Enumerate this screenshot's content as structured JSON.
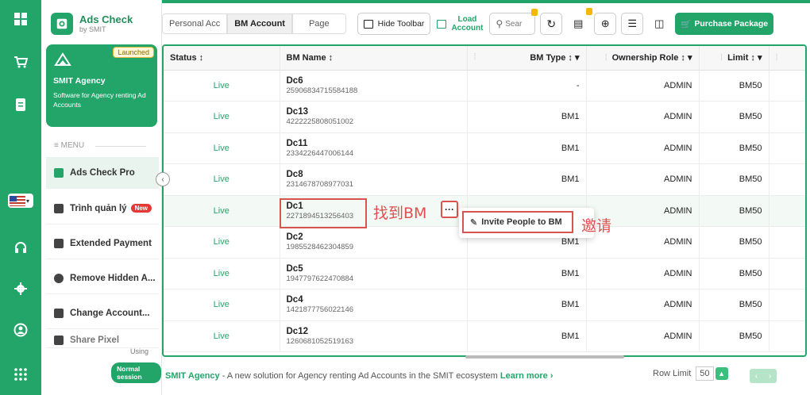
{
  "brand": {
    "name": "Ads Check",
    "sub": "by SMIT"
  },
  "agency_card": {
    "badge": "Launched",
    "title": "SMIT Agency",
    "desc": "Software for Agency renting Ad Accounts"
  },
  "menu": {
    "header": "≡ MENU",
    "items": [
      {
        "label": "Ads Check Pro"
      },
      {
        "label": "Trình quản lý",
        "badge": "New"
      },
      {
        "label": "Extended Payment"
      },
      {
        "label": "Remove Hidden A..."
      },
      {
        "label": "Change Account..."
      },
      {
        "label": "Share Pixel"
      }
    ]
  },
  "session": {
    "using": "Using",
    "badge": "Normal session"
  },
  "toolbar": {
    "tabs": [
      "Personal Acc",
      "BM Account",
      "Page"
    ],
    "hide_toolbar": "Hide Toolbar",
    "load_1": "Load",
    "load_2": "Account",
    "search_placeholder": "Sear",
    "purchase": "Purchase Package"
  },
  "table": {
    "headers": {
      "status": "Status ↕",
      "bm_name": "BM Name ↕",
      "bm_type": "BM Type ↕ ▾",
      "role": "Ownership Role ↕ ▾",
      "limit": "Limit ↕ ▾"
    },
    "rows": [
      {
        "status": "Live",
        "name": "Dc6",
        "id": "25906834715584188",
        "type": "-",
        "role": "ADMIN",
        "limit": "BM50"
      },
      {
        "status": "Live",
        "name": "Dc13",
        "id": "4222225808051002",
        "type": "BM1",
        "role": "ADMIN",
        "limit": "BM50"
      },
      {
        "status": "Live",
        "name": "Dc11",
        "id": "2334226447006144",
        "type": "BM1",
        "role": "ADMIN",
        "limit": "BM50"
      },
      {
        "status": "Live",
        "name": "Dc8",
        "id": "2314678708977031",
        "type": "BM1",
        "role": "ADMIN",
        "limit": "BM50"
      },
      {
        "status": "Live",
        "name": "Dc1",
        "id": "2271894513256403",
        "type": "",
        "role": "ADMIN",
        "limit": "BM50"
      },
      {
        "status": "Live",
        "name": "Dc2",
        "id": "1985528462304859",
        "type": "BM1",
        "role": "ADMIN",
        "limit": "BM50"
      },
      {
        "status": "Live",
        "name": "Dc5",
        "id": "1947797622470884",
        "type": "BM1",
        "role": "ADMIN",
        "limit": "BM50"
      },
      {
        "status": "Live",
        "name": "Dc4",
        "id": "1421877756022146",
        "type": "BM1",
        "role": "ADMIN",
        "limit": "BM50"
      },
      {
        "status": "Live",
        "name": "Dc12",
        "id": "1260681052519163",
        "type": "BM1",
        "role": "ADMIN",
        "limit": "BM50"
      }
    ]
  },
  "annotations": {
    "find_bm": "找到BM",
    "invite": "邀请"
  },
  "popup": {
    "item": "Invite People to BM"
  },
  "footer": {
    "agency": "SMIT Agency",
    "text": " - A new solution for Agency renting Ad Accounts in the SMIT ecosystem ",
    "learn_more": "Learn more ›",
    "row_limit_label": "Row Limit",
    "row_limit_value": "50"
  },
  "colors": {
    "accent": "#23a56a",
    "highlight": "#d9534f"
  }
}
